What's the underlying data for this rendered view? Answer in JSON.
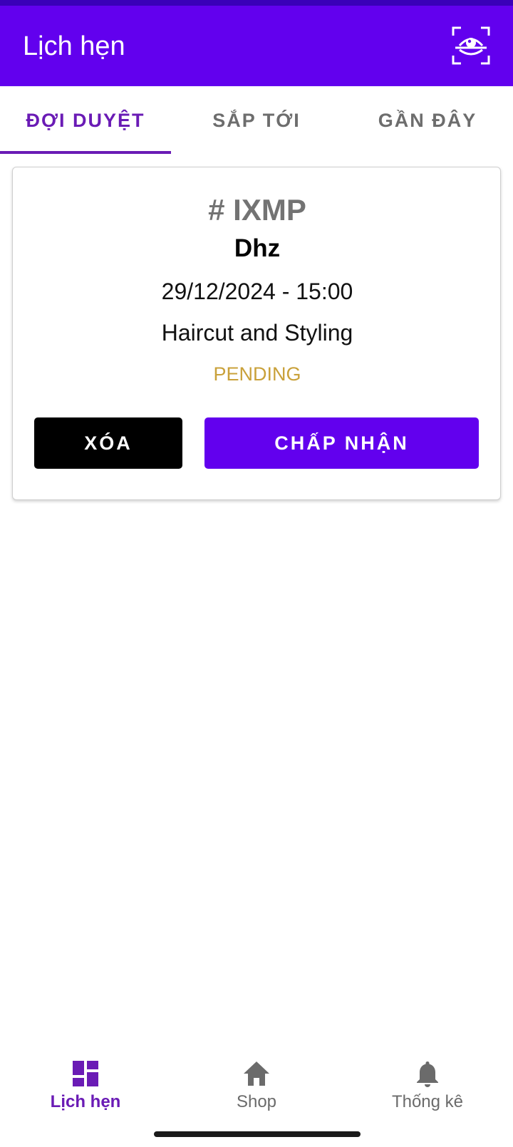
{
  "app_bar": {
    "title": "Lịch hẹn",
    "action_icon": "scan-eye-icon",
    "background": "#6200ee"
  },
  "tabs": [
    {
      "label": "ĐỢI DUYỆT",
      "active": true
    },
    {
      "label": "SẮP TỚI",
      "active": false
    },
    {
      "label": "GẦN ĐÂY",
      "active": false
    }
  ],
  "appointment": {
    "id": "# IXMP",
    "customer": "Dhz",
    "datetime": "29/12/2024 - 15:00",
    "service": "Haircut and Styling",
    "status": "PENDING",
    "status_color": "#c9a13a",
    "delete_label": "XÓA",
    "accept_label": "CHẤP NHẬN"
  },
  "bottom_nav": [
    {
      "label": "Lịch hẹn",
      "icon": "dashboard-icon",
      "active": true
    },
    {
      "label": "Shop",
      "icon": "home-icon",
      "active": false
    },
    {
      "label": "Thống kê",
      "icon": "bell-icon",
      "active": false
    }
  ],
  "colors": {
    "primary": "#6200ee",
    "accent": "#6a1bb5"
  }
}
